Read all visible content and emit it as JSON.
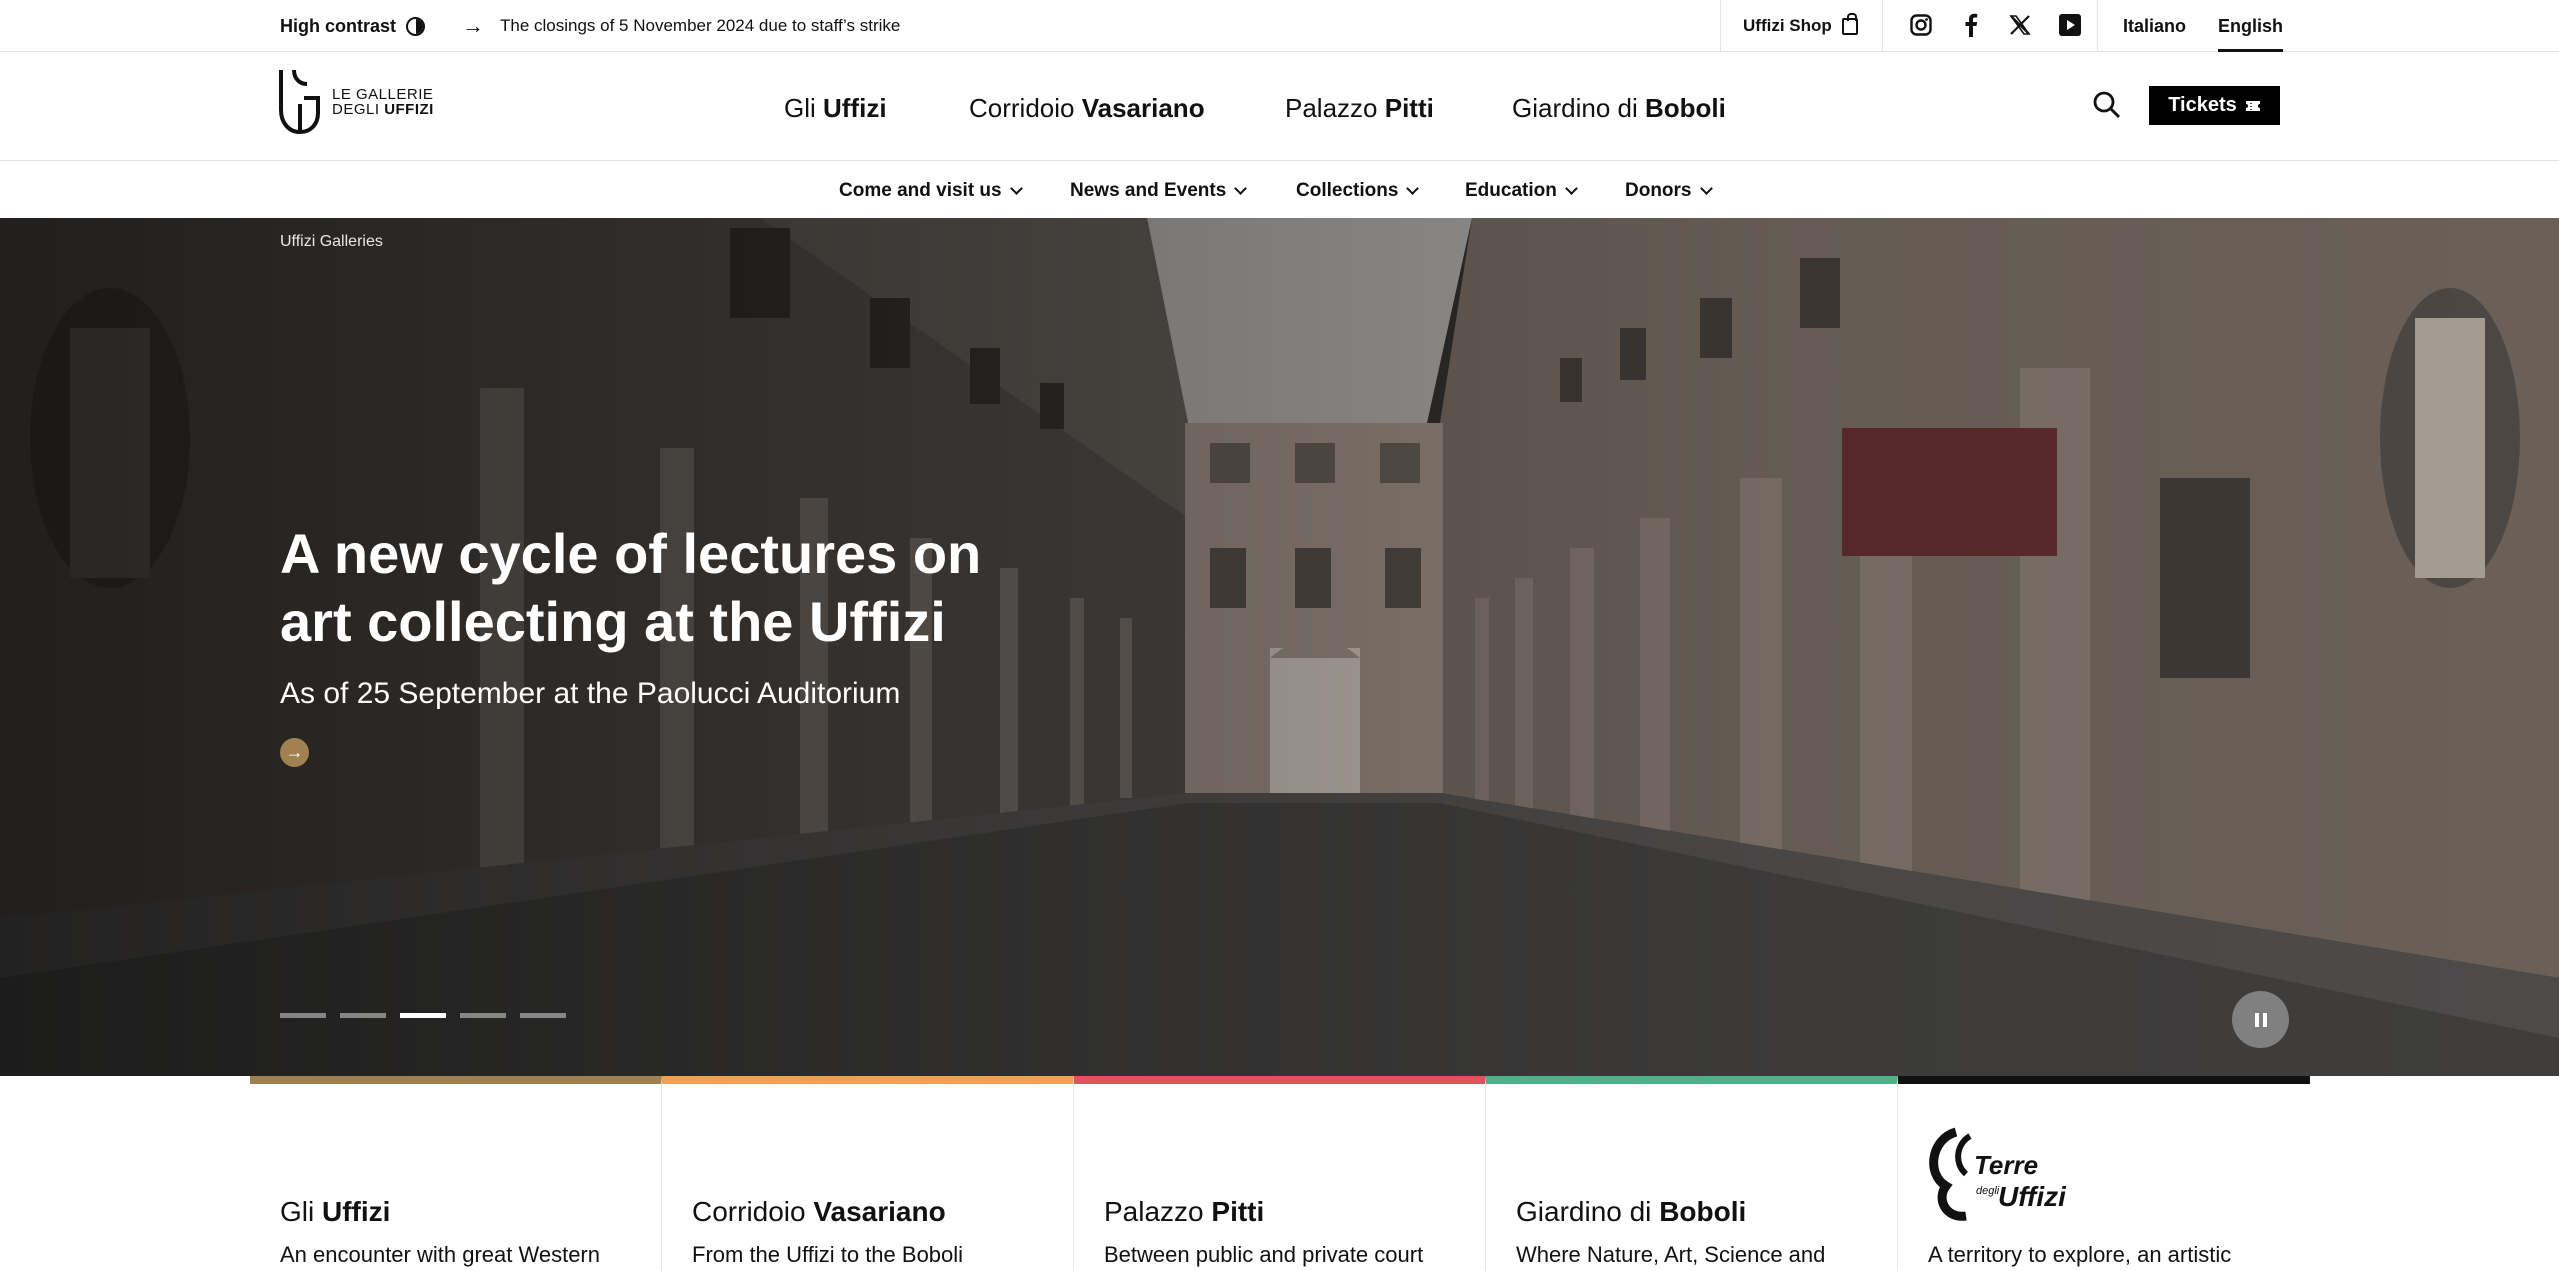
{
  "topbar": {
    "high_contrast": "High contrast",
    "alert": "The closings of 5 November 2024 due to staff’s strike",
    "shop": "Uffizi Shop",
    "social": [
      "instagram-icon",
      "facebook-icon",
      "x-icon",
      "youtube-icon"
    ],
    "languages": [
      {
        "label": "Italiano",
        "active": false
      },
      {
        "label": "English",
        "active": true
      }
    ]
  },
  "header": {
    "logo_line1": "LE GALLERIE",
    "logo_line2_a": "DEGLI ",
    "logo_line2_b": "UFFIZI",
    "sites": [
      {
        "pre": "Gli ",
        "bold": "Uffizi"
      },
      {
        "pre": "Corridoio ",
        "bold": "Vasariano"
      },
      {
        "pre": "Palazzo ",
        "bold": "Pitti"
      },
      {
        "pre": "Giardino di ",
        "bold": "Boboli"
      }
    ],
    "tickets": "Tickets"
  },
  "nav": [
    "Come and visit us",
    "News and Events",
    "Collections",
    "Education",
    "Donors"
  ],
  "hero": {
    "breadcrumb": "Uffizi Galleries",
    "title": "A new cycle of lectures on art collecting at the Uffizi",
    "subtitle": "As of 25 September at the Paolucci Auditorium",
    "slides_total": 5,
    "slide_active": 3
  },
  "cards": [
    {
      "pre": "Gli ",
      "bold": "Uffizi",
      "desc": "An encounter with great Western",
      "color": "#a08050"
    },
    {
      "pre": "Corridoio ",
      "bold": "Vasariano",
      "desc": "From the Uffizi to the Boboli",
      "color": "#f0a055"
    },
    {
      "pre": "Palazzo ",
      "bold": "Pitti",
      "desc": "Between public and private court",
      "color": "#e0525c"
    },
    {
      "pre": "Giardino di ",
      "bold": "Boboli",
      "desc": "Where Nature, Art, Science and",
      "color": "#4fb08a"
    },
    {
      "logo_top": "Terre",
      "logo_mid": "degli",
      "logo_bottom": "Uffizi",
      "desc": "A territory to explore, an artistic",
      "color": "#111111"
    }
  ]
}
